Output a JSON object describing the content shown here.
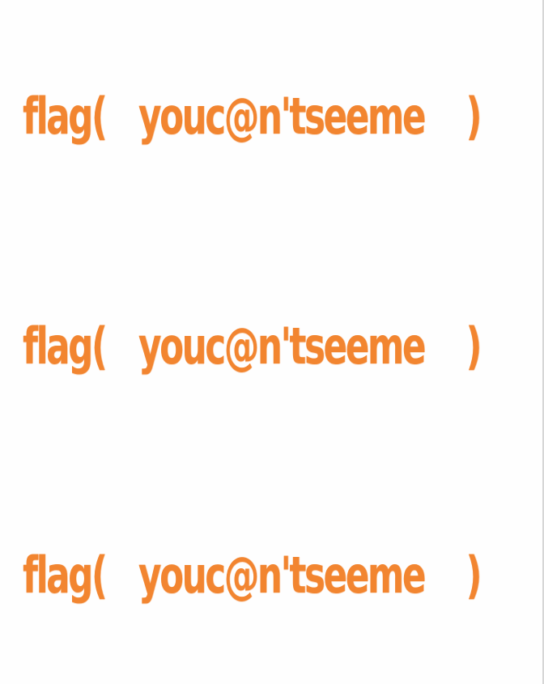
{
  "lines": [
    {
      "prefix": "flag(",
      "secret": "youc@n'tseeme",
      "suffix": ")"
    },
    {
      "prefix": "flag(",
      "secret": "youc@n'tseeme",
      "suffix": ")"
    },
    {
      "prefix": "flag(",
      "secret": "youc@n'tseeme",
      "suffix": ")"
    }
  ],
  "colors": {
    "text": "#f28530",
    "background": "#fefefe",
    "edge": "#d6d6d6"
  }
}
